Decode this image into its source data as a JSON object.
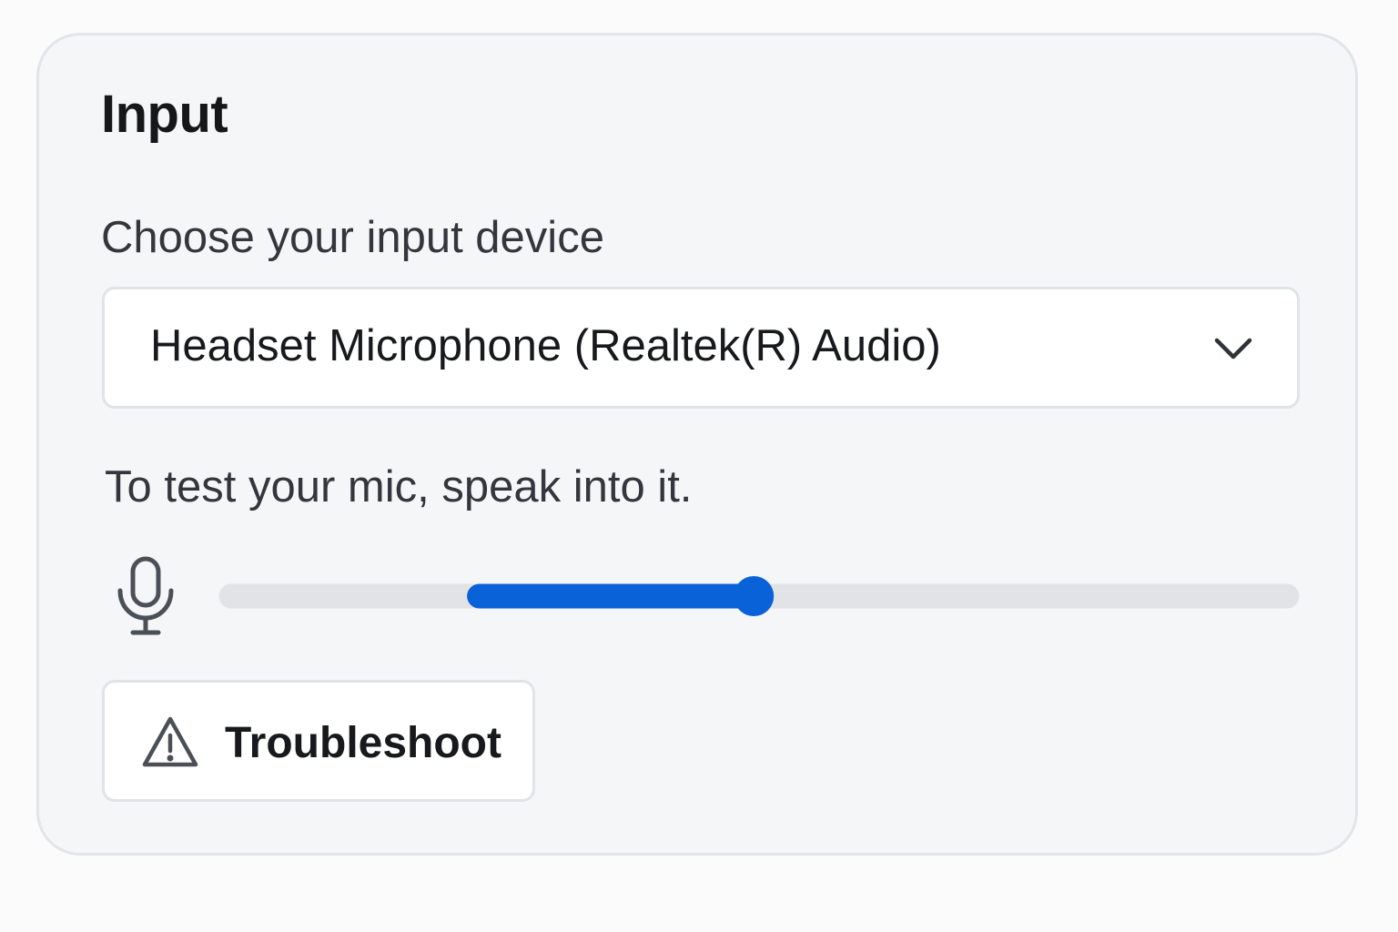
{
  "section": {
    "title": "Input"
  },
  "device": {
    "label": "Choose your input device",
    "selected": "Headset Microphone (Realtek(R) Audio)",
    "dropdown_icon": "chevron-down-icon"
  },
  "mic_test": {
    "instruction": "To test your mic, speak into it.",
    "icon": "microphone-icon",
    "level_start": 0.235,
    "level_end": 0.495
  },
  "troubleshoot": {
    "label": "Troubleshoot",
    "icon": "warning-icon"
  },
  "colors": {
    "accent": "#0a62d8",
    "track": "#e2e3e6",
    "panel_background": "#f5f6f8",
    "text": "#17191c"
  }
}
